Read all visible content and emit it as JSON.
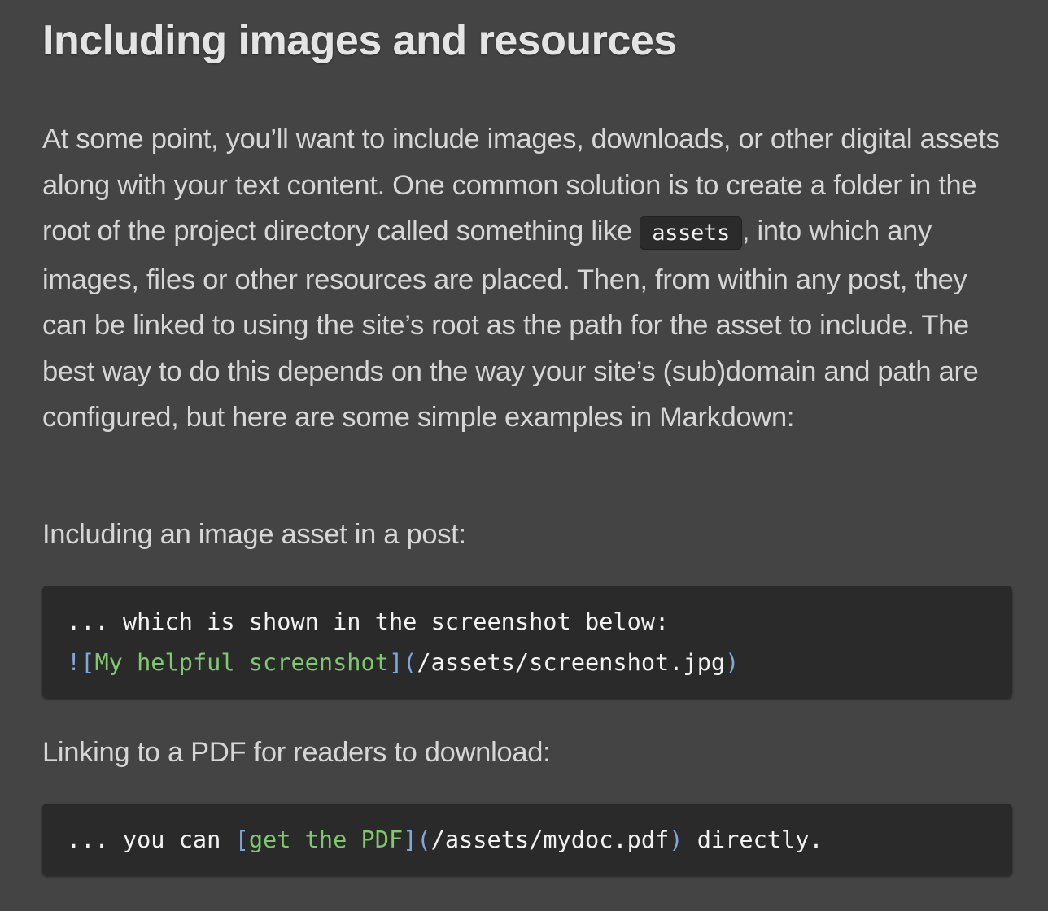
{
  "heading": "Including images and resources",
  "intro": {
    "before": "At some point, you’ll want to include images, downloads, or other digital assets along with your text content. One common solution is to create a folder in the root of the project directory called something like ",
    "code": "assets",
    "after": ", into which any images, files or other resources are placed. Then, from within any post, they can be linked to using the site’s root as the path for the asset to include. The best way to do this depends on the way your site’s (sub)domain and path are configured, but here are some simple examples in Markdown:"
  },
  "example1": {
    "label": "Including an image asset in a post:",
    "line1": "... which is shown in the screenshot below:",
    "bang": "!",
    "open_bracket": "[",
    "link_text": "My helpful screenshot",
    "close_bracket": "]",
    "open_paren": "(",
    "url": "/assets/screenshot.jpg",
    "close_paren": ")"
  },
  "example2": {
    "label": "Linking to a PDF for readers to download:",
    "prefix": "... you can ",
    "open_bracket": "[",
    "link_text": "get the PDF",
    "close_bracket": "]",
    "open_paren": "(",
    "url": "/assets/mydoc.pdf",
    "close_paren": ")",
    "suffix": " directly."
  },
  "colors": {
    "background": "#444444",
    "code_background": "#2a2a2a",
    "syntax_punctuation": "#7fa7d8",
    "syntax_link_text": "#7ec86d"
  }
}
